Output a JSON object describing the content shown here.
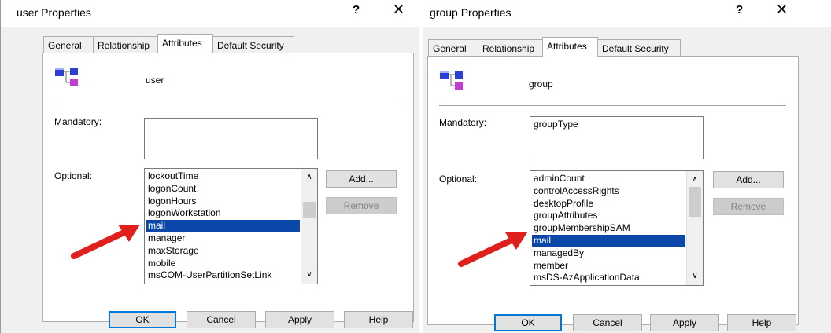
{
  "user_dialog": {
    "title": "user Properties",
    "help_glyph": "?",
    "close_glyph": "✕",
    "tabs": [
      "General",
      "Relationship",
      "Attributes",
      "Default Security"
    ],
    "object_name": "user",
    "mandatory_label": "Mandatory:",
    "mandatory_items": [],
    "optional_label": "Optional:",
    "optional_items": [
      "lockoutTime",
      "logonCount",
      "logonHours",
      "logonWorkstation",
      "mail",
      "manager",
      "maxStorage",
      "mobile",
      "msCOM-UserPartitionSetLink"
    ],
    "selected_item": "mail",
    "add_label": "Add...",
    "remove_label": "Remove",
    "ok_label": "OK",
    "cancel_label": "Cancel",
    "apply_label": "Apply",
    "help_label": "Help"
  },
  "group_dialog": {
    "title": "group Properties",
    "help_glyph": "?",
    "close_glyph": "✕",
    "tabs": [
      "General",
      "Relationship",
      "Attributes",
      "Default Security"
    ],
    "object_name": "group",
    "mandatory_label": "Mandatory:",
    "mandatory_items": [
      "groupType"
    ],
    "optional_label": "Optional:",
    "optional_items": [
      "adminCount",
      "controlAccessRights",
      "desktopProfile",
      "groupAttributes",
      "groupMembershipSAM",
      "mail",
      "managedBy",
      "member",
      "msDS-AzApplicationData"
    ],
    "selected_item": "mail",
    "add_label": "Add...",
    "remove_label": "Remove",
    "ok_label": "OK",
    "cancel_label": "Cancel",
    "apply_label": "Apply",
    "help_label": "Help"
  },
  "colors": {
    "selection": "#0b47a8",
    "annotation_arrow": "#e0201c",
    "default_button_border": "#0078d7"
  },
  "icons": {
    "class_icon": "schema-class-icon",
    "annotation": "red-arrow-icon",
    "scroll_up": "chevron-up-icon",
    "scroll_down": "chevron-down-icon"
  }
}
